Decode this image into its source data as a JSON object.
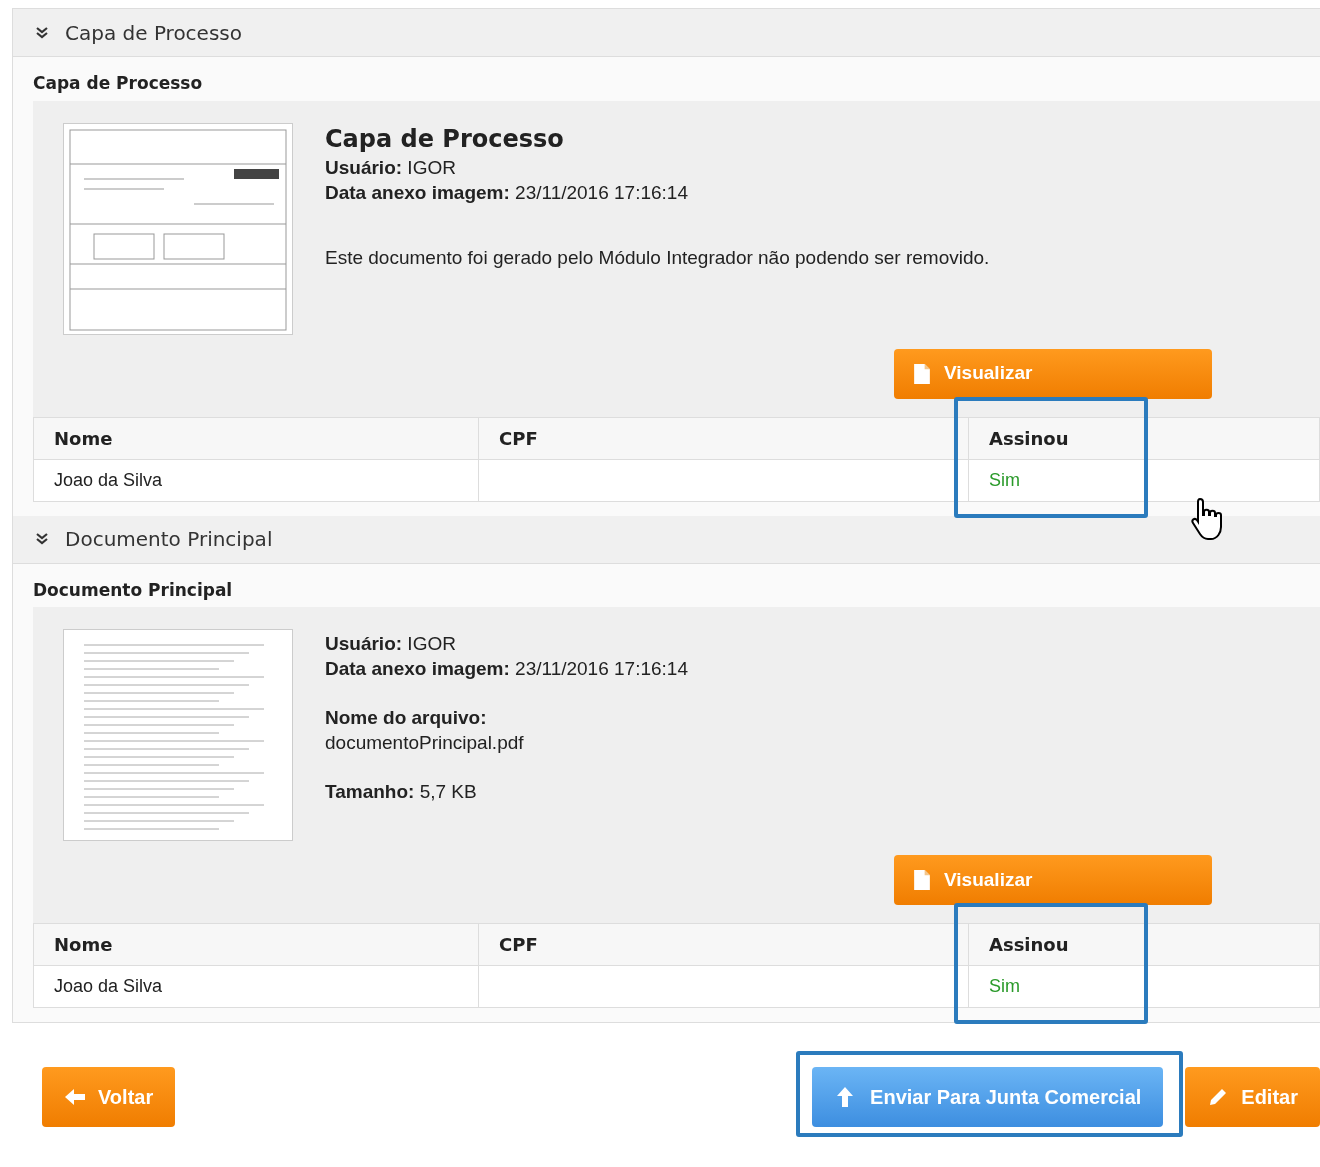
{
  "sections": [
    {
      "header": "Capa de Processo",
      "expanded": true,
      "card_title": "Capa de Processo",
      "document": {
        "heading": "Capa de Processo",
        "fields": [
          {
            "kind": "inline",
            "label": "Usuário:",
            "value": "IGOR"
          },
          {
            "kind": "inline",
            "label": "Data anexo imagem:",
            "value": "23/11/2016 17:16:14"
          }
        ],
        "notice": "Este documento foi gerado pelo Módulo Integrador não podendo ser removido.",
        "button": "Visualizar"
      },
      "table": {
        "columns": [
          {
            "label": "Nome",
            "highlighted": false
          },
          {
            "label": "CPF",
            "highlighted": false
          },
          {
            "label": "Assinou",
            "highlighted": true
          }
        ],
        "rows": [
          [
            "Joao da Silva",
            "",
            "Sim"
          ]
        ]
      }
    },
    {
      "header": "Documento Principal",
      "expanded": true,
      "card_title": "Documento Principal",
      "document": {
        "fields": [
          {
            "kind": "inline",
            "label": "Usuário:",
            "value": "IGOR"
          },
          {
            "kind": "inline",
            "label": "Data anexo imagem:",
            "value": "23/11/2016 17:16:14"
          },
          {
            "kind": "stacked",
            "label": "Nome do arquivo:",
            "value": "documentoPrincipal.pdf"
          },
          {
            "kind": "inline",
            "label": "Tamanho:",
            "value": "5,7 KB"
          }
        ],
        "button": "Visualizar"
      },
      "table": {
        "columns": [
          {
            "label": "Nome",
            "highlighted": false
          },
          {
            "label": "CPF",
            "highlighted": false
          },
          {
            "label": "Assinou",
            "highlighted": true
          }
        ],
        "rows": [
          [
            "Joao da Silva",
            "",
            "Sim"
          ]
        ]
      }
    }
  ],
  "actions": [
    {
      "label": "Voltar",
      "kind": "back",
      "highlighted": false
    },
    {
      "label": "Enviar Para Junta Comercial",
      "kind": "send",
      "highlighted": true
    },
    {
      "label": "Editar",
      "kind": "edit",
      "highlighted": false
    }
  ]
}
